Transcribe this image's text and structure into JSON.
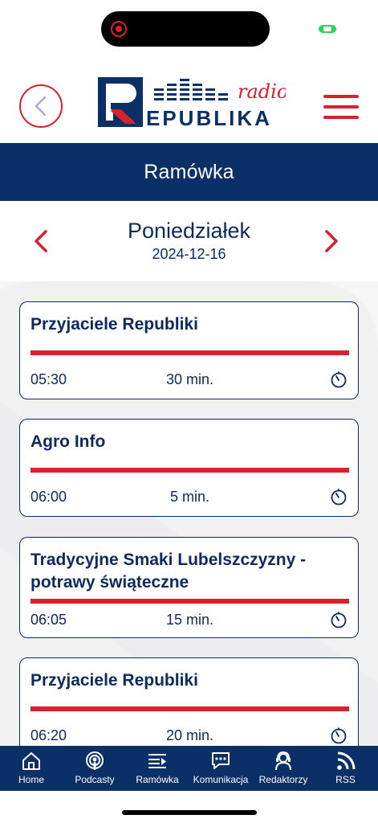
{
  "header": {
    "logo_top": "radio",
    "logo_bottom": "EPUBLIKA"
  },
  "title": "Ramówka",
  "day": {
    "name": "Poniedziałek",
    "date": "2024-12-16"
  },
  "schedule": [
    {
      "title_lines": [
        "Przyjaciele Republiki"
      ],
      "time": "05:30",
      "duration": "30 min."
    },
    {
      "title_lines": [
        "Agro Info"
      ],
      "time": "06:00",
      "duration": "5 min."
    },
    {
      "title_lines": [
        "Tradycyjne Smaki Lubelszczyzny -",
        "potrawy świąteczne"
      ],
      "time": "06:05",
      "duration": "15 min."
    },
    {
      "title_lines": [
        "Przyjaciele Republiki"
      ],
      "time": "06:20",
      "duration": "20 min."
    }
  ],
  "tabs": [
    {
      "label": "Home",
      "icon": "home-icon"
    },
    {
      "label": "Podcasty",
      "icon": "podcast-icon"
    },
    {
      "label": "Ramówka",
      "icon": "schedule-icon"
    },
    {
      "label": "Komunikacja",
      "icon": "chat-icon"
    },
    {
      "label": "Redaktorzy",
      "icon": "editors-icon"
    },
    {
      "label": "RSS",
      "icon": "rss-icon"
    }
  ],
  "colors": {
    "navy": "#0b3067",
    "red": "#d9202f",
    "text": "#0c2a5e"
  }
}
